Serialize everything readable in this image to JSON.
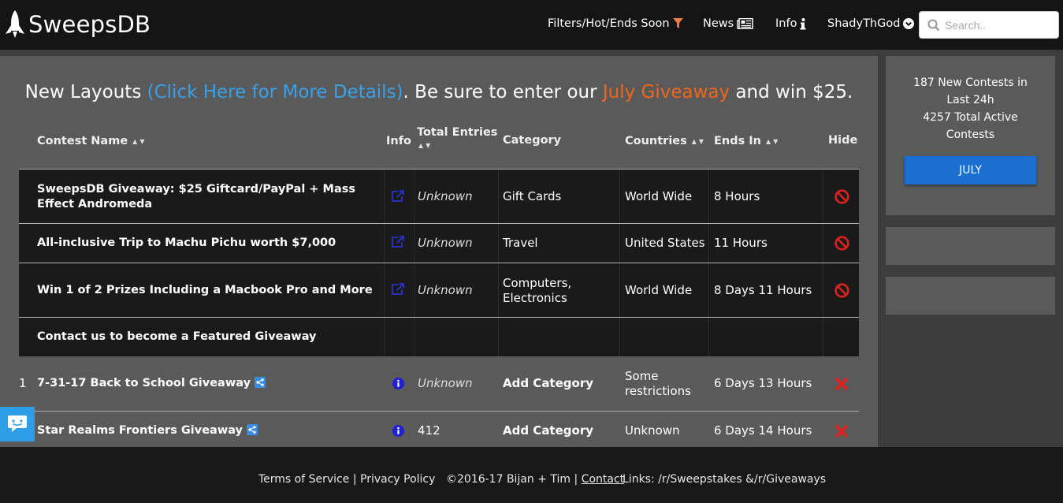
{
  "header": {
    "brand": "SweepsDB",
    "nav": [
      {
        "label": "Filters/Hot/Ends Soon",
        "icon": "funnel-icon"
      },
      {
        "label": "News",
        "icon": "newspaper-icon"
      },
      {
        "label": "Info",
        "icon": "info-icon"
      },
      {
        "label": "ShadyThGod",
        "icon": "chevron-down-circle-icon"
      }
    ],
    "search_placeholder": "Search.."
  },
  "announcement": {
    "part1": "New Layouts ",
    "link": "(Click Here for More Details)",
    "part2": ". Be sure to enter our ",
    "giveaway": "July Giveaway",
    "part3": " and win $25."
  },
  "table": {
    "columns": {
      "name": "Contest Name",
      "info": "Info",
      "entries": "Total Entries",
      "category": "Category",
      "countries": "Countries",
      "ends": "Ends In",
      "hide": "Hide"
    },
    "featured": [
      {
        "name": "SweepsDB Giveaway: $25 Giftcard/PayPal + Mass Effect Andromeda",
        "entries": "Unknown",
        "category": "Gift Cards",
        "countries": "World Wide",
        "ends": "8 Hours"
      },
      {
        "name": "All-inclusive Trip to Machu Pichu worth $7,000",
        "entries": "Unknown",
        "category": "Travel",
        "countries": "United States",
        "ends": "11 Hours"
      },
      {
        "name": "Win 1 of 2 Prizes Including a Macbook Pro and More",
        "entries": "Unknown",
        "category": "Computers, Electronics",
        "countries": "World Wide",
        "ends": "8 Days 11 Hours"
      }
    ],
    "featured_cta": "Contact us to become a Featured Giveaway",
    "rows": [
      {
        "num": "1",
        "name": "7-31-17 Back to School Giveaway",
        "entries": "Unknown",
        "category": "Add Category",
        "countries": "Some restrictions",
        "ends": "6 Days 13 Hours"
      },
      {
        "num": "",
        "name": "Star Realms Frontiers Giveaway",
        "entries": "412",
        "category": "Add Category",
        "countries": "Unknown",
        "ends": "6 Days 14 Hours"
      }
    ]
  },
  "sidebar": {
    "stats_line1": "187 New Contests in",
    "stats_line2": "Last 24h",
    "stats_line3": "4257 Total Active",
    "stats_line4": "Contests",
    "button": "JULY"
  },
  "footer": {
    "terms": "Terms of Service",
    "sep": " | ",
    "privacy": "Privacy Policy",
    "copyright": "©2016-17 Bijan + Tim | ",
    "contact": "Contact",
    "links_label": "Links: ",
    "link1": "/r/Sweepstakes",
    "amp": " &",
    "link2": "/r/Giveaways"
  },
  "colors": {
    "accent_blue": "#3aa0e8",
    "accent_orange": "#f0661d",
    "button_blue": "#1a6fd0",
    "hide_red": "#e0201c"
  }
}
